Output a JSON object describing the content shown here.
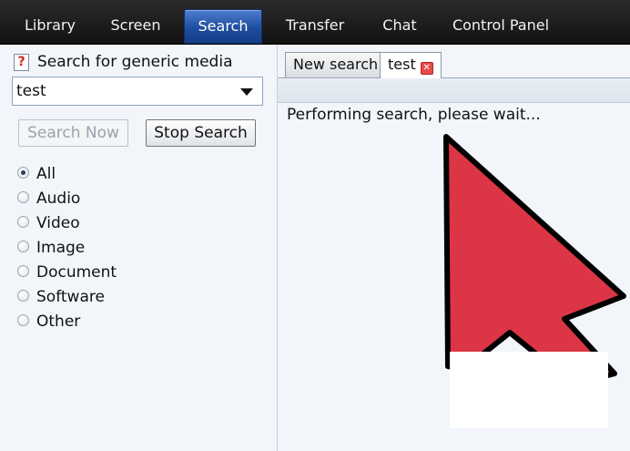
{
  "nav": {
    "tabs": [
      {
        "label": "Library"
      },
      {
        "label": "Screen"
      },
      {
        "label": "Search",
        "active": true
      },
      {
        "label": "Transfer"
      },
      {
        "label": "Chat"
      },
      {
        "label": "Control Panel"
      }
    ]
  },
  "search_panel": {
    "help_icon_glyph": "?",
    "title": "Search for generic media",
    "query_value": "test",
    "search_now_label": "Search Now",
    "stop_search_label": "Stop Search",
    "media_types": [
      {
        "label": "All",
        "checked": true
      },
      {
        "label": "Audio",
        "checked": false
      },
      {
        "label": "Video",
        "checked": false
      },
      {
        "label": "Image",
        "checked": false
      },
      {
        "label": "Document",
        "checked": false
      },
      {
        "label": "Software",
        "checked": false
      },
      {
        "label": "Other",
        "checked": false
      }
    ]
  },
  "results": {
    "tabs": [
      {
        "label": "New search"
      },
      {
        "label": "test",
        "closable": true,
        "selected": true
      }
    ],
    "close_glyph": "✕",
    "status": "Performing search, please wait..."
  },
  "overlay": {
    "arrow_color": "#dc3545",
    "icons": [
      "pointer-arrow-icon",
      "help-icon",
      "close-icon",
      "chevron-down-icon"
    ]
  }
}
